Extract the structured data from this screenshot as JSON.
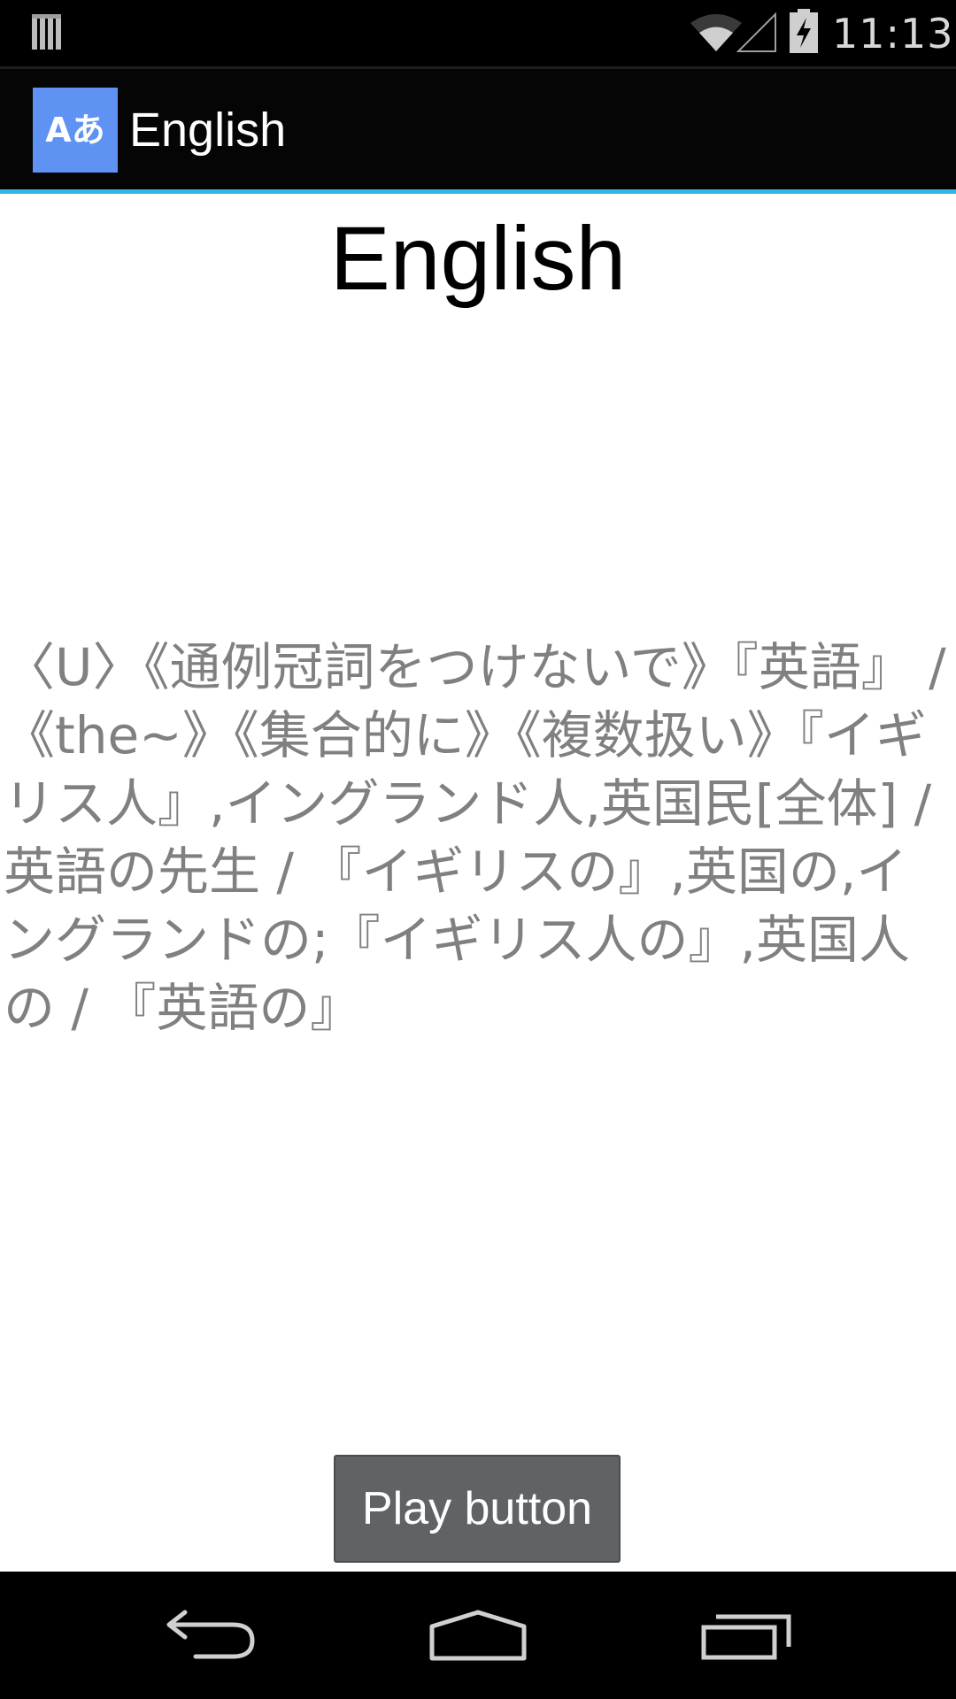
{
  "status_bar": {
    "time": "11:13",
    "icons": [
      "notification-icon",
      "wifi-icon",
      "signal-icon",
      "battery-charging-icon"
    ]
  },
  "action_bar": {
    "app_icon_text": "Aあ",
    "title": "English"
  },
  "content": {
    "word": "English",
    "definition": "〈U〉《通例冠詞をつけないで》『英語』 / 《the~》《集合的に》《複数扱い》『イギリス人』,イングランド人,英国民[全体] / 英語の先生 / 『イギリスの』,英国の,イングランドの;『イギリス人の』,英国人の / 『英語の』"
  },
  "play_button": {
    "label": "Play button"
  },
  "nav_bar": {
    "icons": [
      "back-icon",
      "home-icon",
      "recent-apps-icon"
    ]
  },
  "colors": {
    "accent": "#33b5e5",
    "app_icon_bg": "#5e92f3",
    "definition_text": "#808080",
    "button_bg": "#5f6366"
  }
}
